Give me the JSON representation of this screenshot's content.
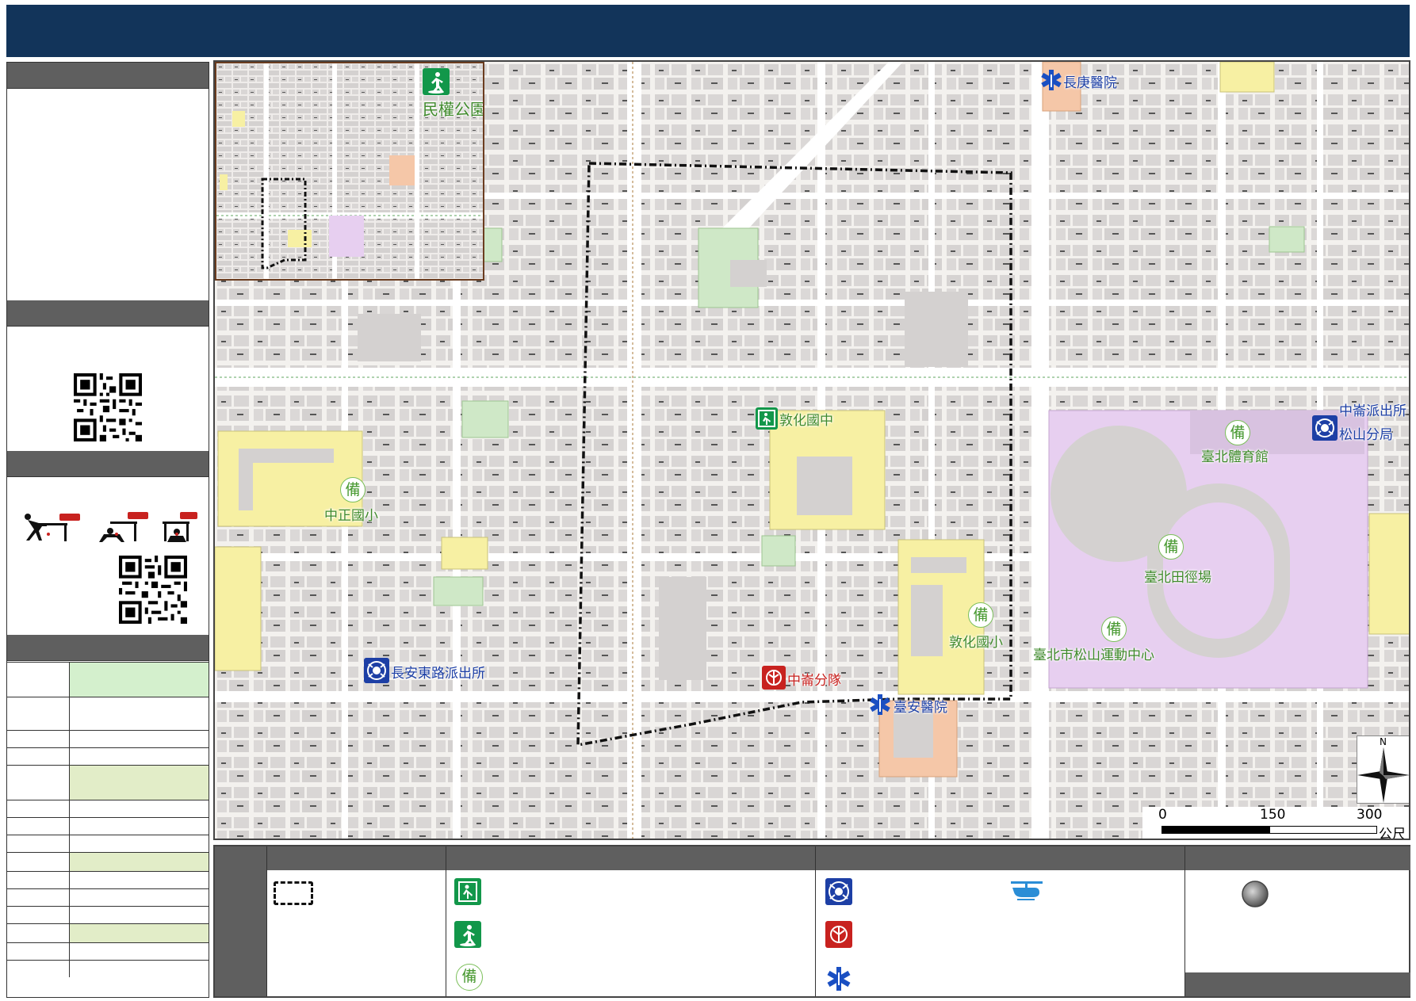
{
  "map_labels": {
    "minquan_park": "民權公園",
    "changgeng_hospital": "長庚醫院",
    "dunhua_junior_high": "敦化國中",
    "zhongzheng_elementary": "中正國小",
    "zhonglun_police_station": "中崙派出所",
    "songshan_police_precinct": "松山分局",
    "taipei_gymnasium": "臺北體育館",
    "taipei_track_field": "臺北田徑場",
    "dunhua_elementary": "敦化國小",
    "songshan_sports_center": "臺北市松山運動中心",
    "changan_east_police_station": "長安東路派出所",
    "zhonglun_fire_squad": "中崙分隊",
    "taian_hospital": "臺安醫院",
    "shelter_symbol": "備"
  },
  "scale_bar": {
    "ticks": [
      "0",
      "150",
      "300"
    ],
    "unit": "公尺"
  },
  "north_arrow": {
    "label": "N"
  },
  "icons": {
    "park": "person-running-icon",
    "evacuation_school": "evacuation-door-icon",
    "police": "police-badge-icon",
    "fire": "fire-department-icon",
    "hospital": "star-of-life-icon",
    "helicopter": "helicopter-icon",
    "point": "gray-circle-icon"
  },
  "colors": {
    "header": "#12345a",
    "section_header": "#5f5f5f",
    "school_fill": "#f7f0a3",
    "sports_fill": "#e7cff0",
    "park_fill": "#cfe8c7",
    "hospital_fill": "#f5c7a8",
    "police_blue": "#1d3fa5",
    "fire_red": "#c8221f",
    "shelter_green": "#3f8a2b"
  }
}
